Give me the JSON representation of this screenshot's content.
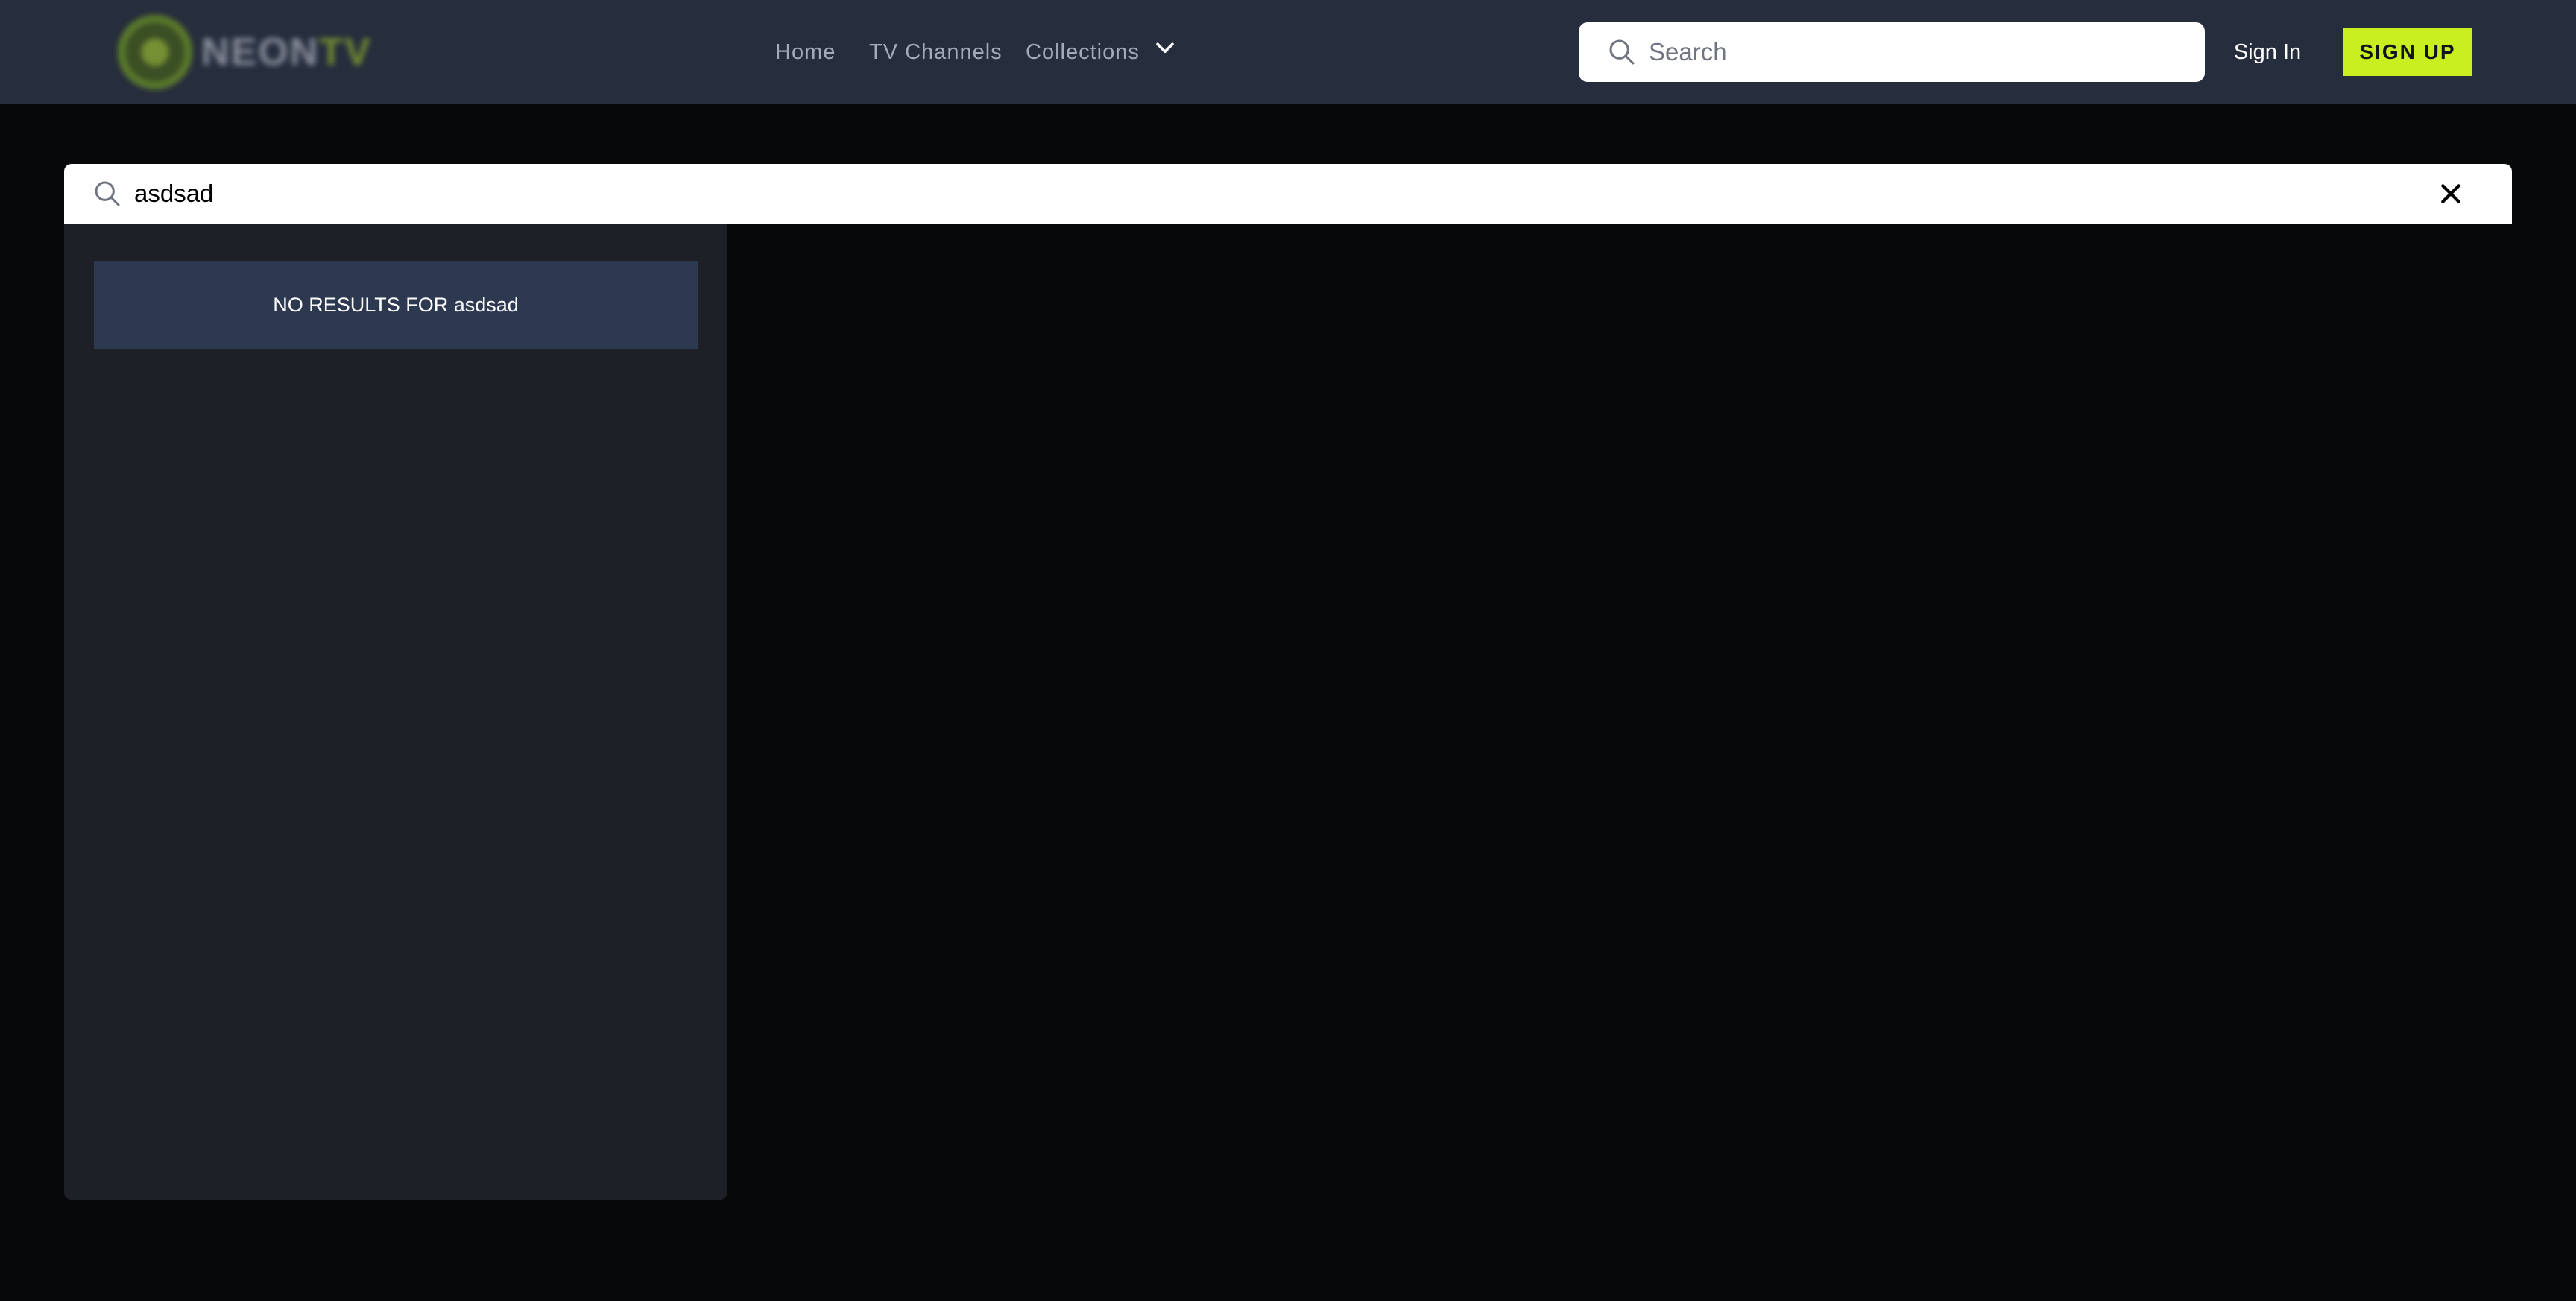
{
  "header": {
    "logo": {
      "text_primary": "NEON",
      "text_accent": "TV"
    },
    "nav": {
      "home": "Home",
      "tv_channels": "TV Channels",
      "collections": "Collections"
    },
    "search": {
      "placeholder": "Search"
    },
    "sign_in": "Sign In",
    "sign_up": "SIGN UP"
  },
  "search_overlay": {
    "query": "asdsad",
    "no_results_text": "NO RESULTS FOR asdsad"
  },
  "colors": {
    "page_background": "#070809",
    "header_background": "#262d3c",
    "accent": "#c8ef20",
    "panel_background": "#1e2028",
    "no_results_background": "#2d3951"
  }
}
